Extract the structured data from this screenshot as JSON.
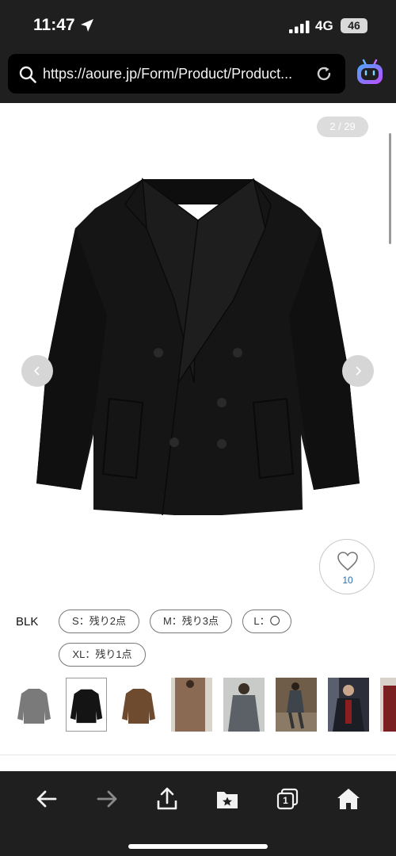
{
  "status": {
    "time": "11:47",
    "network": "4G",
    "battery": "46"
  },
  "browser": {
    "url": "https://aoure.jp/Form/Product/Product...",
    "tab_count": "1"
  },
  "gallery": {
    "counter": "2 / 29"
  },
  "favorite": {
    "count": "10"
  },
  "product": {
    "color_label": "BLK",
    "sizes": [
      {
        "label": "S：残り2点"
      },
      {
        "label": "M：残り3点"
      },
      {
        "label": "L：〇"
      },
      {
        "label": "XL：残り1点"
      }
    ],
    "thumbnails": [
      {
        "name": "gray-coat",
        "color": "#7a7a7a"
      },
      {
        "name": "black-coat",
        "color": "#141414"
      },
      {
        "name": "brown-coat",
        "color": "#6e4a2e"
      },
      {
        "name": "model-brown",
        "color": "#8a6a52"
      },
      {
        "name": "model-gray",
        "color": "#5b6167"
      },
      {
        "name": "model-street",
        "color": "#6f5d4a"
      },
      {
        "name": "model-night",
        "color": "#2c2f3a"
      },
      {
        "name": "model-red",
        "color": "#7a2020"
      }
    ]
  },
  "colors": {
    "bar_bg": "#1f1f1f",
    "accent_blue": "#2b6cb0"
  }
}
